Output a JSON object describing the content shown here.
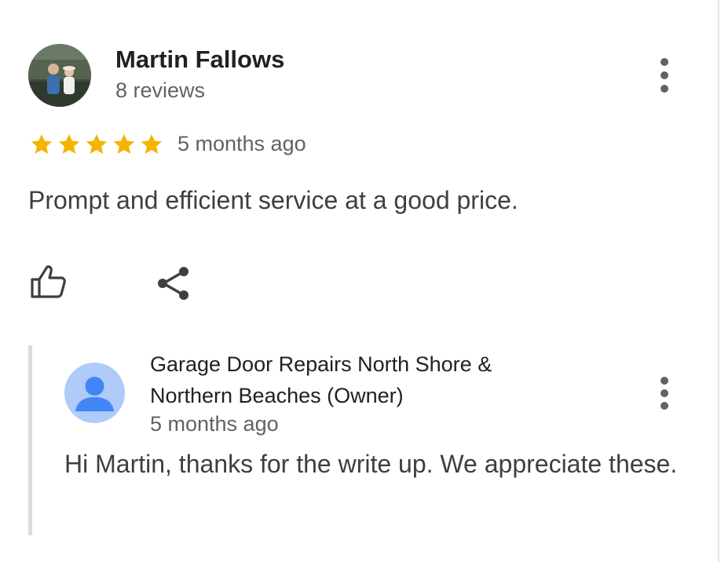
{
  "review": {
    "reviewer": {
      "name": "Martin Fallows",
      "review_count": "8 reviews",
      "avatar_icon": "user-photo-avatar"
    },
    "rating": 5,
    "rating_max": 5,
    "star_color": "#f4b400",
    "time": "5 months ago",
    "text": "Prompt and efficient service at a good price.",
    "actions": {
      "like_icon": "thumbs-up-icon",
      "share_icon": "share-icon",
      "more_icon": "more-vertical-icon"
    }
  },
  "owner_reply": {
    "name_line1": "Garage Door Repairs North Shore &",
    "name_line2": "Northern Beaches (Owner)",
    "time": "5 months ago",
    "text": "Hi Martin, thanks for the write up. We appreciate these.",
    "avatar_icon": "default-person-avatar",
    "avatar_bg": "#aecbfa",
    "avatar_fg": "#4285f4"
  }
}
